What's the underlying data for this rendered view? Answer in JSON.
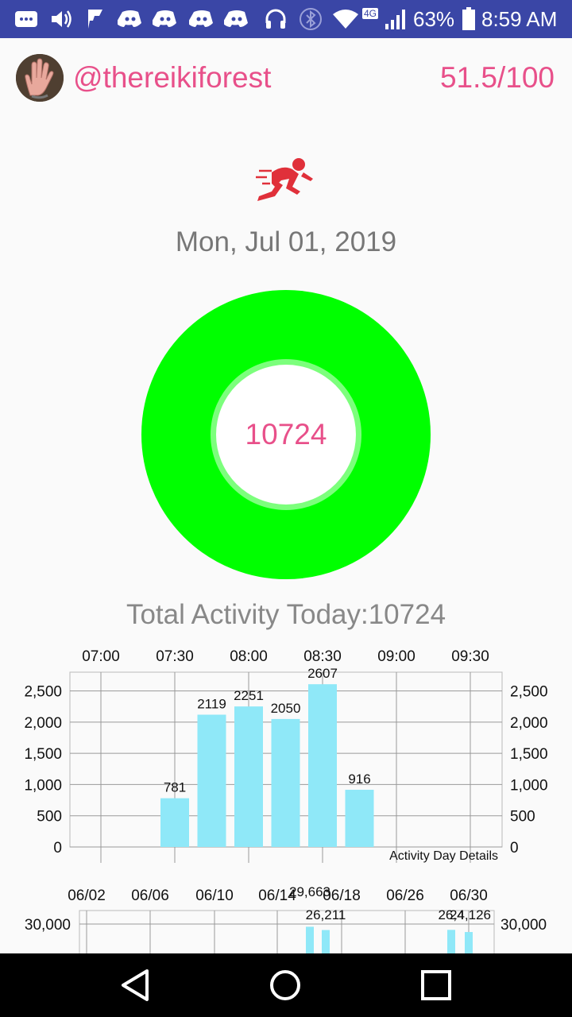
{
  "status_bar": {
    "battery": "63%",
    "time": "8:59 AM",
    "network": "4G",
    "icons": [
      "message-icon",
      "volume-icon",
      "flipboard-icon",
      "discord-icon",
      "discord-icon",
      "discord-icon",
      "discord-icon",
      "headphones-icon",
      "bluetooth-icon",
      "wifi-icon",
      "signal-icon",
      "battery-icon"
    ]
  },
  "header": {
    "username": "@thereikiforest",
    "score": "51.5/100"
  },
  "activity": {
    "date": "Mon, Jul 01, 2019",
    "ring_value": "10724",
    "ring_progress": 1.0,
    "total_label": "Total Activity Today:10724"
  },
  "colors": {
    "accent": "#e8508a",
    "ring": "#00ff00",
    "ring_inner": "#7cff7c",
    "bar": "#8fe8f8",
    "status_bar": "#3a46a6"
  },
  "chart_data": [
    {
      "type": "bar",
      "title": "Activity Day Details",
      "x_ticks": [
        "07:00",
        "07:30",
        "08:00",
        "08:30",
        "09:00",
        "09:30"
      ],
      "categories": [
        "07:30",
        "07:45",
        "08:00",
        "08:15",
        "08:30",
        "08:45"
      ],
      "values": [
        781,
        2119,
        2251,
        2050,
        2607,
        916
      ],
      "value_labels": [
        "781",
        "2119",
        "2251",
        "2050",
        "2607",
        "916"
      ],
      "y_ticks": [
        "0",
        "500",
        "1,000",
        "1,500",
        "2,000",
        "2,500"
      ],
      "ylim": [
        0,
        2800
      ],
      "grid": true
    },
    {
      "type": "bar",
      "x_ticks": [
        "06/02",
        "06/06",
        "06/10",
        "06/14",
        "06/18",
        "06/26",
        "06/30"
      ],
      "y_ticks": [
        "30,000"
      ],
      "value_labels": [
        "29,663",
        "26,211",
        "26,4",
        "24,126"
      ],
      "values": [
        29663,
        26211,
        26400,
        24126
      ]
    }
  ]
}
